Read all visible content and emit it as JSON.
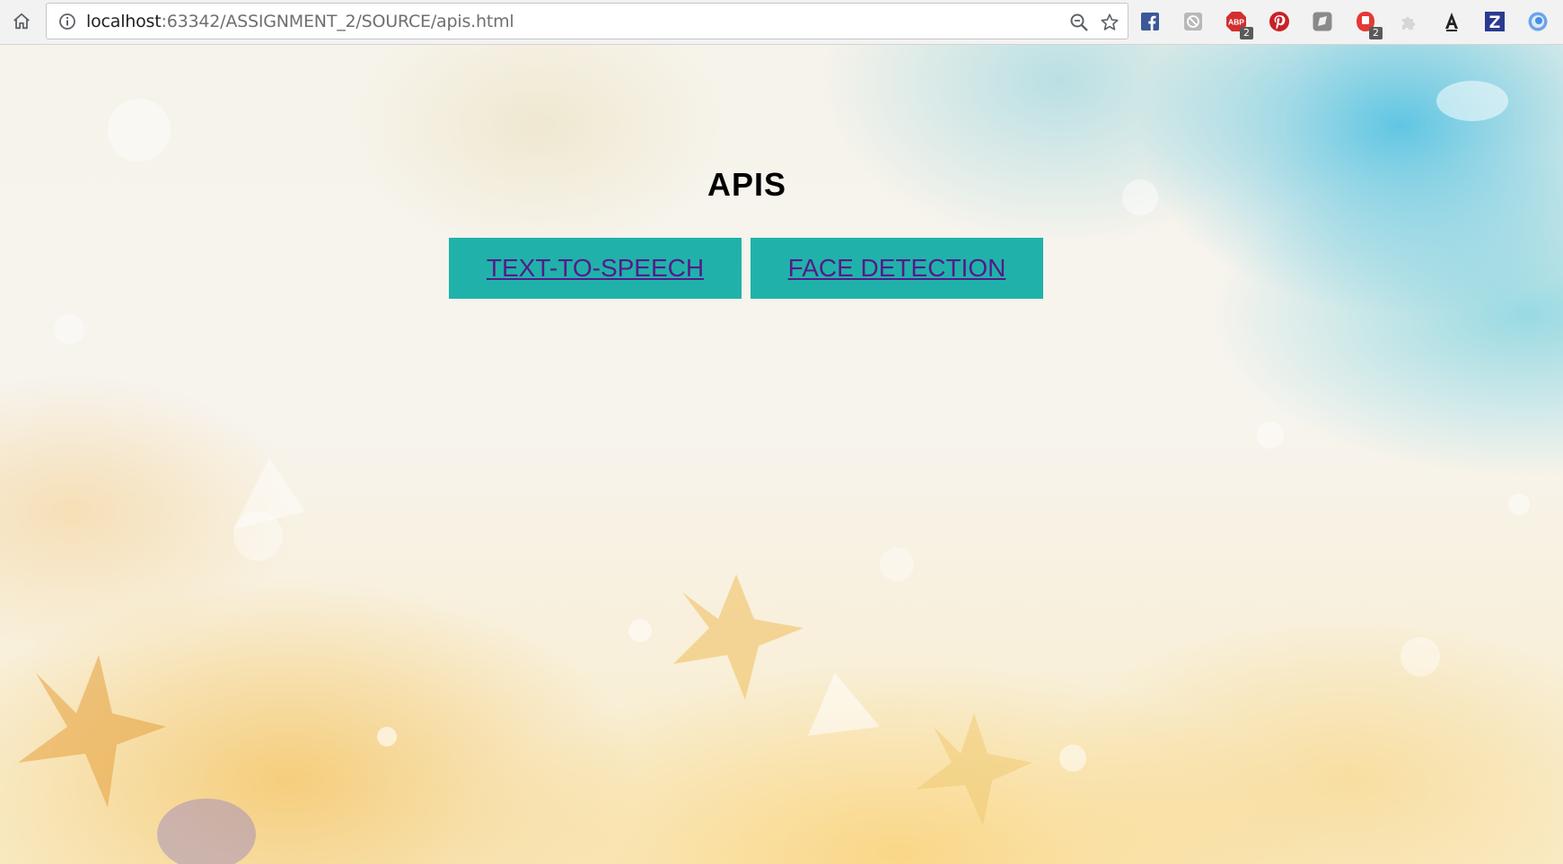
{
  "browser": {
    "url_host": "localhost",
    "url_path": ":63342/ASSIGNMENT_2/SOURCE/apis.html",
    "extensions": [
      {
        "name": "facebook",
        "color": "#3b5998"
      },
      {
        "name": "blocker",
        "color": "#9e9e9e"
      },
      {
        "name": "adblock-plus",
        "color": "#d32f2f",
        "badge": "2"
      },
      {
        "name": "pinterest",
        "color": "#cb2027"
      },
      {
        "name": "gray-extension",
        "color": "#8a8a8a"
      },
      {
        "name": "red-extension",
        "color": "#e53935",
        "badge": "2"
      },
      {
        "name": "gray-puzzle",
        "color": "#c9c9c9"
      },
      {
        "name": "a-extension",
        "color": "#222222"
      },
      {
        "name": "z-extension",
        "color": "#2b3a8f"
      },
      {
        "name": "blue-circle",
        "color": "#4a8fe0"
      }
    ]
  },
  "page": {
    "heading": "APIS",
    "buttons": [
      {
        "label": "TEXT-TO-SPEECH"
      },
      {
        "label": "FACE DETECTION"
      }
    ],
    "colors": {
      "button_bg": "#20b2aa",
      "link": "#551a8b"
    }
  }
}
